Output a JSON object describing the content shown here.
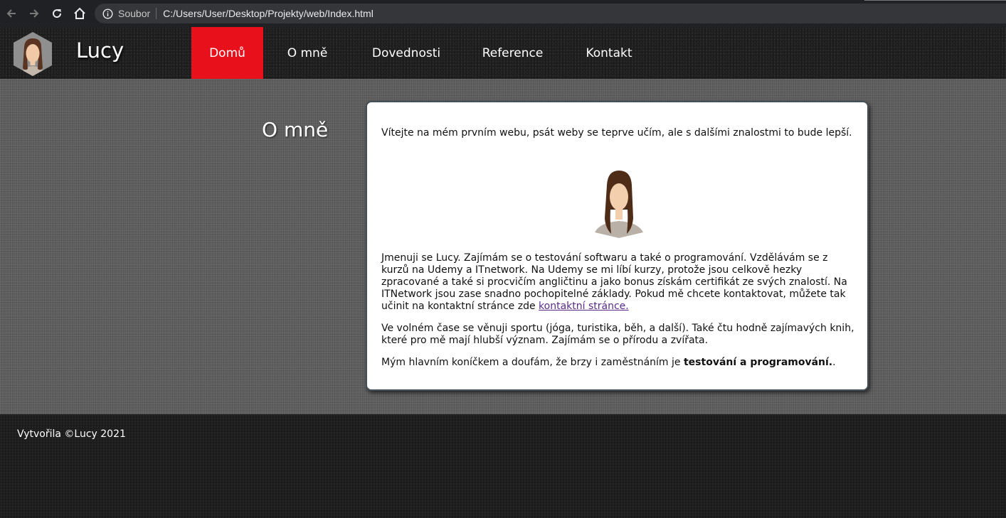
{
  "browser": {
    "scheme_label": "Soubor",
    "url": "C:/Users/User/Desktop/Projekty/web/Index.html",
    "icons": [
      "back-arrow-icon",
      "forward-arrow-icon",
      "reload-icon",
      "home-icon",
      "info-icon"
    ]
  },
  "header": {
    "site_title": "Lucy",
    "menu": [
      {
        "label": "Domů",
        "active": true
      },
      {
        "label": "O mně",
        "active": false
      },
      {
        "label": "Dovednosti",
        "active": false
      },
      {
        "label": "Reference",
        "active": false
      },
      {
        "label": "Kontakt",
        "active": false
      }
    ]
  },
  "main": {
    "heading": "O mně",
    "intro": "Vítejte na mém prvním webu, psát weby se teprve učím, ale s dalšími znalostmi to bude lepší.",
    "paragraph1_text": "Jmenuji se Lucy. Zajímám se o testování softwaru a také o programování. Vzdělávám se z kurzů na Udemy a ITnetwork. Na Udemy se mi líbí kurzy, protože jsou celkově hezky zpracované a také si procvičím angličtinu a jako bonus získám certifikát ze svých znalostí. Na ITNetwork jsou zase snadno pochopitelné základy. Pokud mě chcete kontaktovat, můžete tak učinit na kontaktní stránce zde ",
    "contact_link": "kontaktní stránce.",
    "paragraph2": "Ve volném čase se věnuji sportu (jóga, turistika, běh, a další). Také čtu hodně zajímavých knih, které pro mě mají hlubší význam. Zajímám se o přírodu a zvířata.",
    "paragraph3_text": "Mým hlavním koníčkem a doufám, že brzy i zaměstnáním je ",
    "paragraph3_strong": "testování a programování.",
    "paragraph3_end": "."
  },
  "footer": {
    "text": "Vytvořila ©Lucy 2021"
  },
  "colors": {
    "accent": "#e8101b",
    "link": "#5a2a8a"
  }
}
